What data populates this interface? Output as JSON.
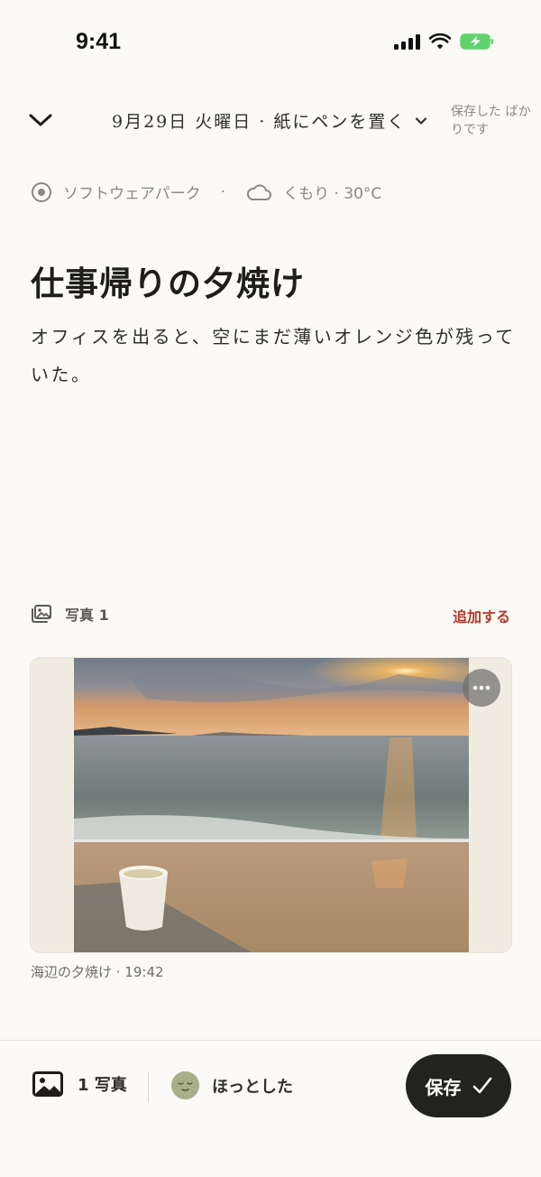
{
  "status_bar": {
    "time": "9:41"
  },
  "header": {
    "title": "9月29日 火曜日 · 紙にペンを置く",
    "save_status": "保存した ばかりです"
  },
  "meta": {
    "location": "ソフトウェアパーク",
    "separator": "·",
    "weather": "くもり · 30°C"
  },
  "entry": {
    "title": "仕事帰りの夕焼け",
    "body": "オフィスを出ると、空にまだ薄いオレンジ色が残っていた。"
  },
  "photos": {
    "label": "写真 1",
    "add_label": "追加する",
    "caption": "海辺の夕焼け · 19:42"
  },
  "bottom_bar": {
    "photo_count": "1 写真",
    "mood": "ほっとした",
    "save_label": "保存"
  },
  "colors": {
    "background": "#fbfaf6",
    "accent_red": "#b23c2c",
    "save_button": "#23231e",
    "mood_face": "#a8ae88"
  }
}
